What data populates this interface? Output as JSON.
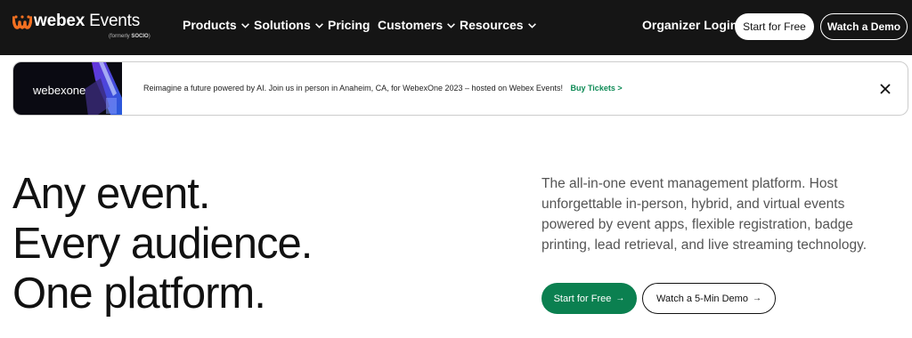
{
  "nav": {
    "logo_bold": "webex",
    "logo_rest": " Events",
    "logo_sub_prefix": "(formerly ",
    "logo_sub_bold": "SOCIO",
    "logo_sub_suffix": ")",
    "items": [
      {
        "label": "Products",
        "has_menu": true
      },
      {
        "label": "Solutions",
        "has_menu": true
      },
      {
        "label": "Pricing",
        "has_menu": false
      },
      {
        "label": "Customers",
        "has_menu": true
      },
      {
        "label": "Resources",
        "has_menu": true
      }
    ],
    "organizer_login": "Organizer Login",
    "start_free": "Start for Free",
    "watch_demo": "Watch a Demo"
  },
  "banner": {
    "brand_prefix": "webex",
    "brand_suffix": "one",
    "text": "Reimagine a future powered by AI. Join us in person in Anaheim, CA, for WebexOne 2023 – hosted on Webex Events!",
    "link": "Buy Tickets >",
    "close_icon": "close-icon"
  },
  "hero": {
    "title_lines": [
      "Any event.",
      "Every audience.",
      "One platform."
    ],
    "description": "The all-in-one event management platform. Host unforgettable in-person, hybrid, and virtual events powered by event apps, flexible registration, badge printing, lead retrieval, and live streaming technology.",
    "start_button": "Start for Free",
    "watch_button": "Watch a 5-Min Demo",
    "arrow": "→"
  },
  "colors": {
    "nav_bg": "#151515",
    "accent_green": "#0b8050",
    "link_green": "#0d8a55",
    "logo_orange": "#f37021"
  }
}
